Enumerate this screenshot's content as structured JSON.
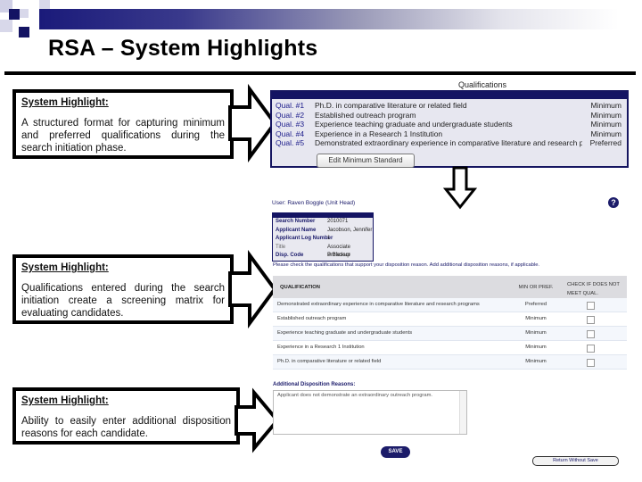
{
  "slide": {
    "title": "RSA – System Highlights",
    "brand_colors": {
      "navy": "#141463",
      "light_square": "#c8c8e0"
    }
  },
  "callouts": [
    {
      "heading": "System Highlight:",
      "text": "A structured format for capturing minimum and preferred qualifications during the search initiation phase."
    },
    {
      "heading": "System Highlight:",
      "text": "Qualifications entered during the search initiation create a screening matrix for evaluating candidates."
    },
    {
      "heading": "System Highlight:",
      "text": "Ability to easily enter additional disposition reasons for each candidate."
    }
  ],
  "qualifications_panel": {
    "title": "Qualifications",
    "rows": [
      {
        "label": "Qual. #1",
        "description": "Ph.D. in comparative literature or related field",
        "level": "Minimum"
      },
      {
        "label": "Qual. #2",
        "description": "Established outreach program",
        "level": "Minimum"
      },
      {
        "label": "Qual. #3",
        "description": "Experience teaching graduate and undergraduate students",
        "level": "Minimum"
      },
      {
        "label": "Qual. #4",
        "description": "Experience in a Research 1 Institution",
        "level": "Minimum"
      },
      {
        "label": "Qual. #5",
        "description": "Demonstrated extraordinary experience in comparative literature and research programs",
        "level": "Preferred"
      }
    ],
    "edit_button": "Edit Minimum Standard"
  },
  "disposition_panel": {
    "user_line": "User: Raven Boggle (Unit Head)",
    "info": [
      {
        "key": "Search Number",
        "value": "2010071"
      },
      {
        "key": "Applicant Name",
        "value": "Jacobson, Jennifer"
      },
      {
        "key": "Applicant Log Number",
        "value": "1"
      },
      {
        "key": "Title",
        "value": "Associate Professor"
      },
      {
        "key": "Disp. Code",
        "value": "B Backup"
      }
    ],
    "help_icon": "?",
    "instruction": "Please check the qualifications that support your disposition reason. Add additional disposition reasons, if applicable.",
    "grid_headers": {
      "qualification": "QUALIFICATION",
      "min_pref": "MIN OR PREF.",
      "check": "CHECK IF DOES NOT MEET QUAL."
    },
    "grid_rows": [
      {
        "qualification": "Demonstrated extraordinary experience in comparative literature and research programs",
        "min_pref": "Preferred",
        "checked": false
      },
      {
        "qualification": "Established outreach program",
        "min_pref": "Minimum",
        "checked": false
      },
      {
        "qualification": "Experience teaching graduate and undergraduate students",
        "min_pref": "Minimum",
        "checked": false
      },
      {
        "qualification": "Experience in a Research 1 Institution",
        "min_pref": "Minimum",
        "checked": false
      },
      {
        "qualification": "Ph.D. in comparative literature or related field",
        "min_pref": "Minimum",
        "checked": false
      }
    ],
    "additional_label": "Additional Disposition Reasons:",
    "additional_text": "Applicant does not demonstrate an extraordinary outreach program.",
    "save_button": "SAVE",
    "return_button": "Return Without Save"
  }
}
